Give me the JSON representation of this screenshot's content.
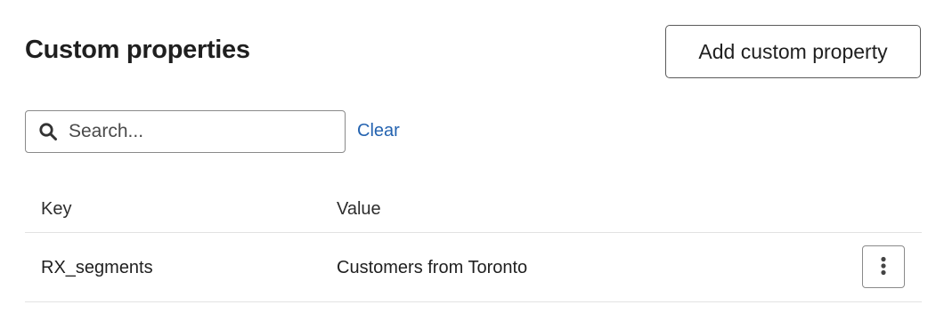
{
  "header": {
    "title": "Custom properties",
    "add_button_label": "Add custom property"
  },
  "search": {
    "placeholder": "Search...",
    "value": "",
    "icon": "search-icon",
    "clear_label": "Clear"
  },
  "table": {
    "columns": [
      "Key",
      "Value"
    ],
    "rows": [
      {
        "key": "RX_segments",
        "value": "Customers from Toronto",
        "actions_icon": "more-vertical-icon"
      }
    ]
  },
  "colors": {
    "link": "#2463b0",
    "border": "#8a8a8a",
    "divider": "#e2e2e2"
  }
}
